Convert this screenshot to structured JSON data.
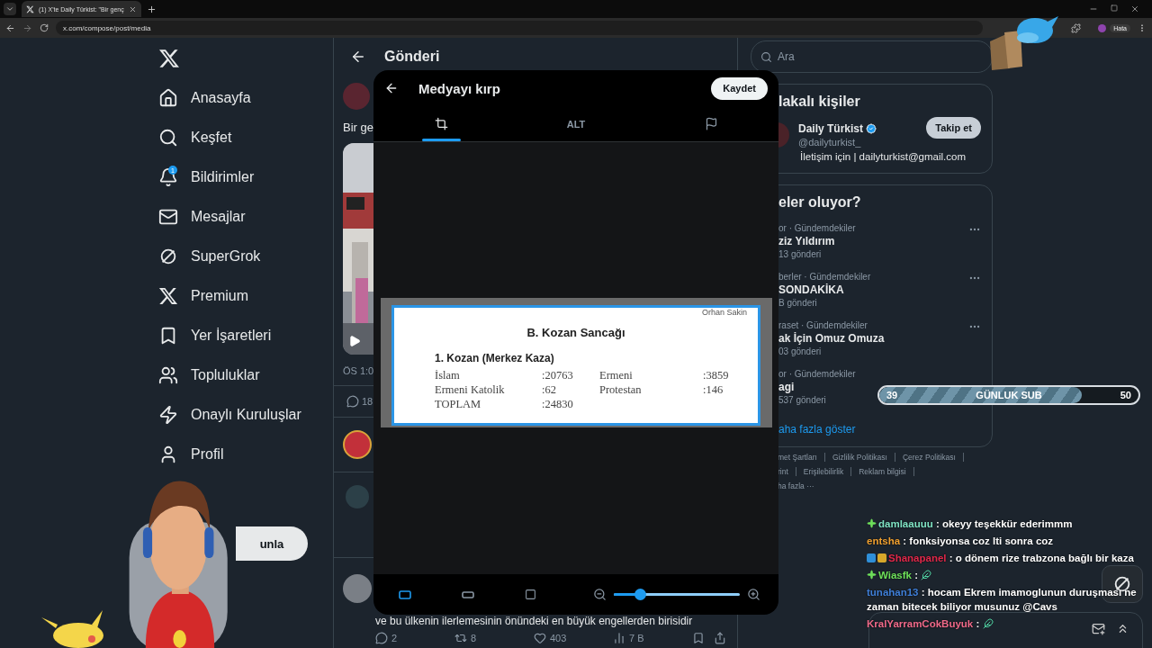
{
  "browser": {
    "tab_title": "(1) X'te Daily Türkist: \"Bir genç",
    "url": "x.com/compose/post/media",
    "profile": "Hata"
  },
  "nav": {
    "items": [
      {
        "label": "Anasayfa"
      },
      {
        "label": "Keşfet"
      },
      {
        "label": "Bildirimler",
        "badge": "1"
      },
      {
        "label": "Mesajlar"
      },
      {
        "label": "SuperGrok"
      },
      {
        "label": "Premium"
      },
      {
        "label": "Yer İşaretleri"
      },
      {
        "label": "Topluluklar"
      },
      {
        "label": "Onaylı Kuruluşlar"
      },
      {
        "label": "Profil"
      }
    ],
    "post_button": "unla"
  },
  "post": {
    "header": "Gönderi",
    "text": "Bir ge",
    "time": "ÖS 1:0",
    "replies": "18"
  },
  "reply": {
    "text": "ve bu ülkenin ilerlemesinin önündeki en büyük engellerden birisidir",
    "stats": [
      {
        "kind": "reply",
        "value": "2"
      },
      {
        "kind": "repost",
        "value": "8"
      },
      {
        "kind": "like",
        "value": "403"
      },
      {
        "kind": "views",
        "value": "7 B"
      }
    ]
  },
  "dialog": {
    "title": "Medyayı kırp",
    "save": "Kaydet",
    "tabs": [
      {
        "kind": "crop",
        "selected": true
      },
      {
        "kind": "text",
        "label": "ALT",
        "selected": false
      },
      {
        "kind": "flag",
        "selected": false
      }
    ],
    "document": {
      "author": "Orhan Sakin",
      "title": "B. Kozan Sancağı",
      "subtitle": "1. Kozan (Merkez Kaza)",
      "rows": [
        [
          "İslam",
          ":20763",
          "Ermeni",
          ":3859"
        ],
        [
          "Ermeni Katolik",
          ":62",
          "Protestan",
          ":146"
        ],
        [
          "TOPLAM",
          ":24830"
        ]
      ]
    },
    "aspects": [
      {
        "kind": "original",
        "selected": true
      },
      {
        "kind": "wide",
        "selected": false
      },
      {
        "kind": "square",
        "selected": false
      }
    ],
    "zoom": {
      "level": 0.18
    }
  },
  "search": {
    "placeholder": "Ara"
  },
  "related": {
    "title": "lakalı kişiler",
    "name": "Daily Türkist",
    "handle": "@dailyturkist_",
    "follow": "Takip et",
    "bio": "İletişim için | dailyturkist@gmail.com"
  },
  "trends": {
    "title": "eler oluyor?",
    "items": [
      {
        "meta": "or · Gündemdekiler",
        "topic": "ziz Yıldırım",
        "count": "13 gönderi",
        "menu": true
      },
      {
        "meta": "berler · Gündemdekiler",
        "topic": "SONDAKİKA",
        "count": "B gönderi",
        "menu": true
      },
      {
        "meta": "raset · Gündemdekiler",
        "topic": "ak İçin Omuz Omuza",
        "count": "03 gönderi",
        "menu": true
      },
      {
        "meta": "or · Gündemdekiler",
        "topic": "agi",
        "count": "537 gönderi",
        "menu": false
      }
    ],
    "more": "aha fazla göster"
  },
  "footer": [
    [
      "met Şartları",
      "Gizlilik Politikası",
      "Çerez Politikası"
    ],
    [
      "rint",
      "Erişilebilirlik",
      "Reklam bilgisi"
    ],
    [
      "ha fazla ···"
    ]
  ],
  "sub_goal": {
    "current": "39",
    "label": "GÜNLUK SUB",
    "target": "50",
    "level": 0.78
  },
  "chat": [
    {
      "user": "damlaauuu",
      "color": "#7fe3c4",
      "badges": [
        {
          "kind": "sparkle"
        }
      ],
      "sep": ":",
      "kind": "text",
      "text": "okeyy teşekkür ederimmm"
    },
    {
      "user": "entsha",
      "color": "#f0a030",
      "sep": ":",
      "kind": "text",
      "text": "fonksiyonsa coz lti sonra coz"
    },
    {
      "user": "Shanapanel",
      "color": "#e0284a",
      "badges": [
        {
          "kind": "blue"
        },
        {
          "kind": "gold"
        }
      ],
      "sep": ":",
      "kind": "text",
      "text": "o dönem rize trabzona bağlı bir kaza"
    },
    {
      "user": "Wiasfk",
      "color": "#6ee05a",
      "badges": [
        {
          "kind": "sparkle"
        }
      ],
      "sep": ":",
      "kind": "emote"
    },
    {
      "user": "tunahan13",
      "color": "#3f7fd8",
      "sep": ":",
      "kind": "text",
      "text": "hocam Ekrem imamoglunun duruşması ne zaman bitecek biliyor musunuz @Cavs"
    },
    {
      "user": "KralYarramCokBuyuk",
      "color": "#f06a8a",
      "sep": ":",
      "kind": "emote"
    }
  ]
}
